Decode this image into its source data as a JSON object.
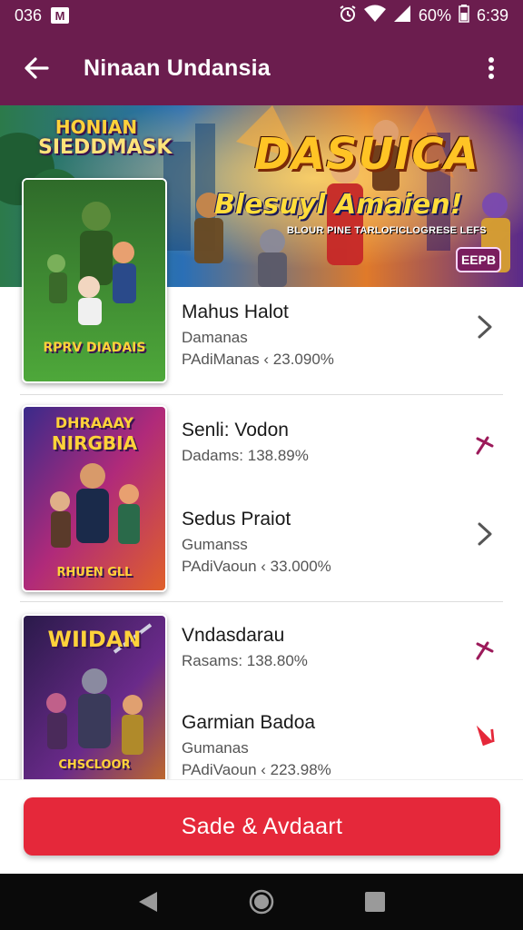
{
  "status_bar": {
    "time_left": "036",
    "notification_badge": "M",
    "battery": "60%",
    "time_right": "6:39",
    "icons": [
      "alarm-icon",
      "wifi-icon",
      "signal-icon",
      "battery-icon"
    ]
  },
  "app_bar": {
    "title": "Ninaan Undansia",
    "icons": [
      "back-arrow-icon",
      "more-vert-icon"
    ]
  },
  "banner": {
    "logo_line1": "HONIAN",
    "logo_line2": "SIEDDMASK",
    "title": "DASUICA",
    "subtitle": "Blesuyl Amaien!",
    "tagline": "BLOUR PINE TARLOFICLOGRESE LEFS",
    "badge": "EEPB"
  },
  "covers": [
    {
      "title": "RPRV DIADAIS"
    },
    {
      "title_line1": "DHRAAAY",
      "title_line2": "NIRGBIA",
      "footer": "RHUEN GLL"
    },
    {
      "title": "WIIDAN",
      "footer": "CHSCLOOR"
    }
  ],
  "items": [
    {
      "title": "Mahus Halot",
      "subtitle": "Damanas",
      "meta": "PAdiManas ‹ 23.090%",
      "chevron_color": "#555555"
    },
    {
      "title": "Senli: Vodon",
      "subtitle": "Dadams: 138.89%",
      "meta": "",
      "chevron_color": "#9c1a5a"
    },
    {
      "title": "Sedus Praiot",
      "subtitle": "Gumanss",
      "meta": "PAdiVaoun ‹ 33.000%",
      "chevron_color": "#555555"
    },
    {
      "title": "Vndasdarau",
      "subtitle": "Rasams: 138.80%",
      "meta": "",
      "chevron_color": "#9c1a5a"
    },
    {
      "title": "Garmian Badoa",
      "subtitle": "Gumanas",
      "meta": "PAdiVaoun ‹ 223.98%",
      "chevron_color": "#e5283a"
    }
  ],
  "cta": {
    "label": "Sade & Avdaart"
  },
  "nav_bar": {
    "icons": [
      "nav-back-icon",
      "nav-home-icon",
      "nav-recents-icon"
    ]
  },
  "colors": {
    "primary": "#6b1d4e",
    "accent": "#e5283a",
    "chevron_purple": "#9c1a5a"
  }
}
